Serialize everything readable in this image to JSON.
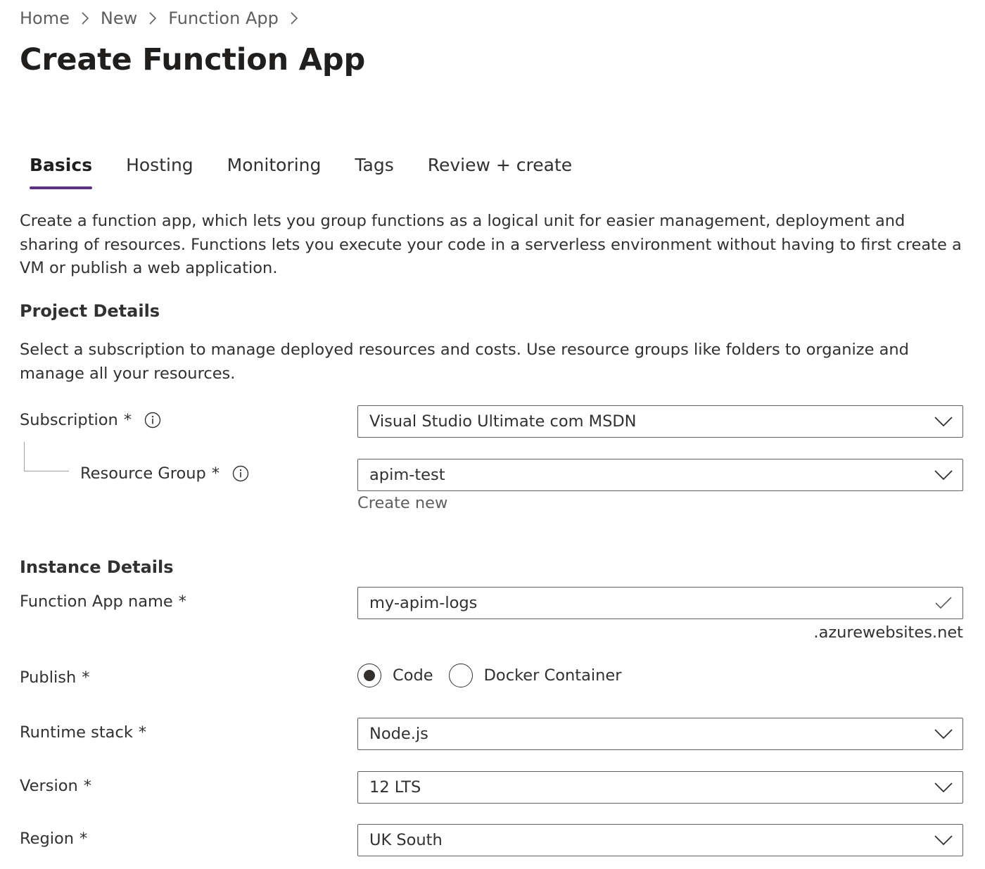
{
  "breadcrumb": {
    "items": [
      "Home",
      "New",
      "Function App"
    ]
  },
  "page": {
    "title": "Create Function App"
  },
  "tabs": [
    {
      "label": "Basics",
      "active": true
    },
    {
      "label": "Hosting",
      "active": false
    },
    {
      "label": "Monitoring",
      "active": false
    },
    {
      "label": "Tags",
      "active": false
    },
    {
      "label": "Review + create",
      "active": false
    }
  ],
  "intro": "Create a function app, which lets you group functions as a logical unit for easier management, deployment and sharing of resources. Functions lets you execute your code in a serverless environment without having to first create a VM or publish a web application.",
  "project_details": {
    "heading": "Project Details",
    "description": "Select a subscription to manage deployed resources and costs. Use resource groups like folders to organize and manage all your resources.",
    "subscription": {
      "label": "Subscription",
      "required": "*",
      "value": "Visual Studio Ultimate com MSDN"
    },
    "resource_group": {
      "label": "Resource Group",
      "required": "*",
      "value": "apim-test",
      "create_new": "Create new"
    }
  },
  "instance_details": {
    "heading": "Instance Details",
    "function_app_name": {
      "label": "Function App name",
      "required": "*",
      "value": "my-apim-logs",
      "suffix": ".azurewebsites.net"
    },
    "publish": {
      "label": "Publish",
      "required": "*",
      "options": [
        "Code",
        "Docker Container"
      ],
      "selected": "Code"
    },
    "runtime_stack": {
      "label": "Runtime stack",
      "required": "*",
      "value": "Node.js"
    },
    "version": {
      "label": "Version",
      "required": "*",
      "value": "12 LTS"
    },
    "region": {
      "label": "Region",
      "required": "*",
      "value": "UK South"
    }
  },
  "colors": {
    "accent": "#5c2e91",
    "text": "#323130",
    "border": "#605e5c"
  }
}
